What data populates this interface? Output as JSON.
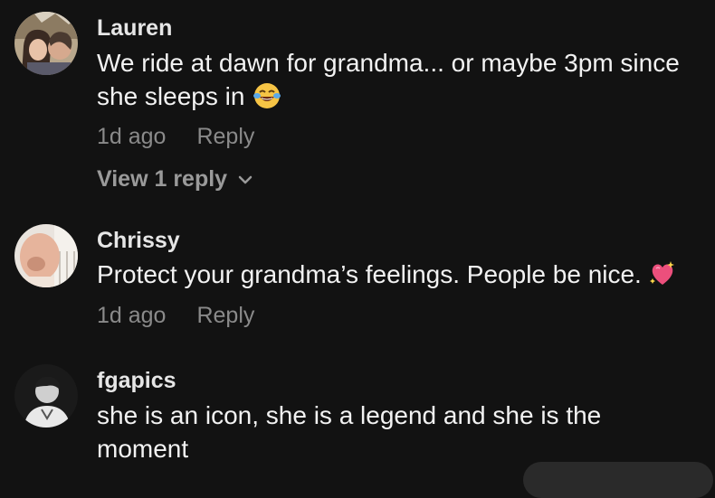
{
  "comments": [
    {
      "username": "Lauren",
      "text": "We ride at dawn for grandma... or maybe 3pm since she sleeps in",
      "emoji": "laughing-tears-emoji",
      "time": "1d ago",
      "reply_label": "Reply",
      "view_replies_label": "View 1 reply"
    },
    {
      "username": "Chrissy",
      "text": "Protect your grandma’s feelings. People be nice.",
      "emoji": "sparkling-heart-emoji",
      "time": "1d ago",
      "reply_label": "Reply"
    },
    {
      "username": "fgapics",
      "text": "she is an icon, she is a legend and she is the moment"
    }
  ],
  "colors": {
    "background": "#121212",
    "username": "#e6e6e6",
    "body_text": "#f2f2f2",
    "meta_text": "#8a8a8a"
  }
}
